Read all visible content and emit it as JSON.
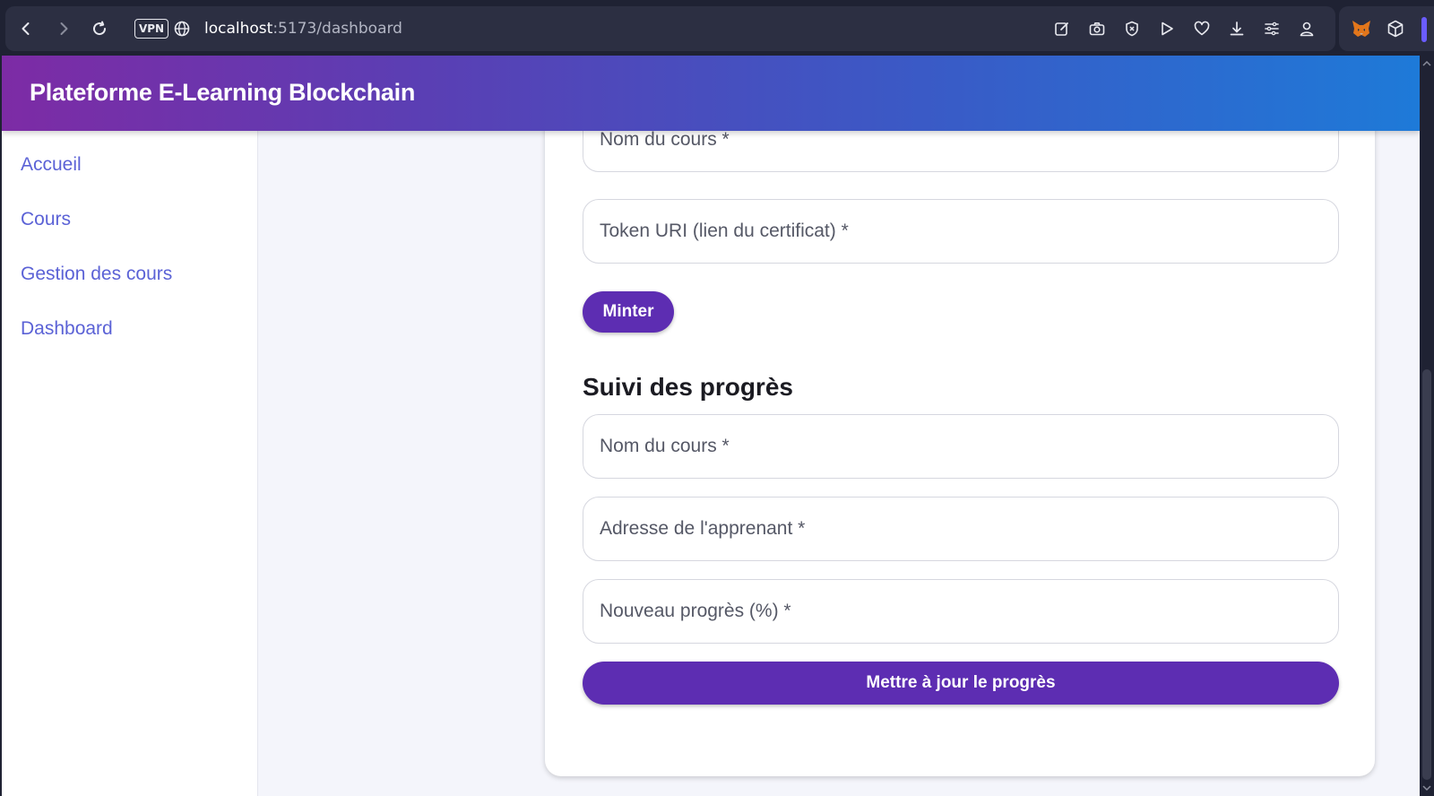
{
  "browser": {
    "vpn_label": "VPN",
    "url_host": "localhost",
    "url_path": ":5173/dashboard",
    "toolbar_icons": [
      "edit-icon",
      "camera-icon",
      "shield-icon",
      "play-icon",
      "heart-icon",
      "download-icon",
      "menu-icon",
      "account-icon"
    ],
    "extensions": [
      "metamask-fox-icon",
      "cube-icon"
    ]
  },
  "header": {
    "title": "Plateforme E-Learning Blockchain"
  },
  "sidebar": {
    "items": [
      {
        "label": "Accueil"
      },
      {
        "label": "Cours"
      },
      {
        "label": "Gestion des cours"
      },
      {
        "label": "Dashboard"
      }
    ]
  },
  "mint_form": {
    "course_name_placeholder": "Nom du cours *",
    "token_uri_placeholder": "Token URI (lien du certificat) *",
    "mint_button": "Minter"
  },
  "progress_section": {
    "title": "Suivi des progrès",
    "course_name_placeholder": "Nom du cours *",
    "learner_address_placeholder": "Adresse de l'apprenant *",
    "new_progress_placeholder": "Nouveau progrès (%) *",
    "update_button": "Mettre à jour le progrès"
  },
  "colors": {
    "primary": "#5d2db2",
    "link": "#5b62d6",
    "header_gradient_start": "#7d2ba5",
    "header_gradient_end": "#1e7ad8"
  }
}
